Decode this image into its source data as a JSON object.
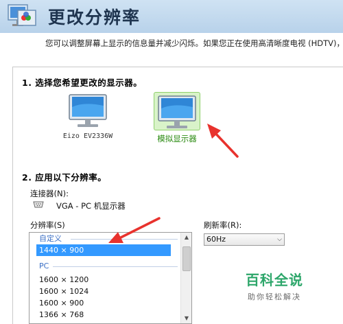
{
  "header": {
    "title": "更改分辨率",
    "description": "您可以调整屏幕上显示的信息量并减少闪烁。如果您正在使用高清晰度电视 (HDTV)，"
  },
  "section1": {
    "title": "1. 选择您希望更改的显示器。",
    "monitors": [
      {
        "label": "Eizo EV2336W",
        "selected": false,
        "icon": "monitor-icon"
      },
      {
        "label": "模拟显示器",
        "selected": true,
        "icon": "monitor-icon"
      }
    ]
  },
  "section2": {
    "title": "2. 应用以下分辨率。",
    "connector_label": "连接器(N):",
    "connector_value": "VGA - PC 机显示器",
    "resolution_label": "分辨率(S)",
    "refresh_label": "刷新率(R):",
    "refresh_value": "60Hz",
    "groups": [
      {
        "name": "自定义",
        "items": [
          "1440 × 900"
        ]
      },
      {
        "name": "PC",
        "items": [
          "1600 × 1200",
          "1600 × 1024",
          "1600 × 900",
          "1366 × 768"
        ]
      }
    ],
    "selected_resolution": "1440 × 900"
  },
  "watermark": {
    "title": "百科全说",
    "subtitle": "助你轻松解决"
  },
  "colors": {
    "header_bg": "#cfe2f3",
    "selection": "#3399ff",
    "group_text": "#3b6fc5",
    "selected_monitor_bg": "#d9f3c9",
    "annotation_arrow": "#e8322d",
    "watermark_green": "#2da66a"
  }
}
